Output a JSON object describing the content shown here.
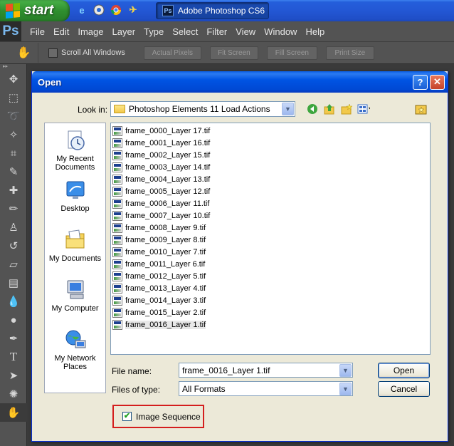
{
  "taskbar": {
    "start_label": "start",
    "task_label": "Adobe Photoshop CS6"
  },
  "menubar": {
    "logo": "Ps",
    "items": [
      "File",
      "Edit",
      "Image",
      "Layer",
      "Type",
      "Select",
      "Filter",
      "View",
      "Window",
      "Help"
    ]
  },
  "options_bar": {
    "scroll_all_label": "Scroll All Windows",
    "buttons": [
      "Actual Pixels",
      "Fit Screen",
      "Fill Screen",
      "Print Size"
    ]
  },
  "dialog": {
    "title": "Open",
    "help_symbol": "?",
    "close_symbol": "✕",
    "look_in_label": "Look in:",
    "look_in_value": "Photoshop Elements 11 Load Actions",
    "places": [
      "My Recent Documents",
      "Desktop",
      "My Documents",
      "My Computer",
      "My Network Places"
    ],
    "files": [
      "frame_0000_Layer 17.tif",
      "frame_0001_Layer 16.tif",
      "frame_0002_Layer 15.tif",
      "frame_0003_Layer 14.tif",
      "frame_0004_Layer 13.tif",
      "frame_0005_Layer 12.tif",
      "frame_0006_Layer 11.tif",
      "frame_0007_Layer 10.tif",
      "frame_0008_Layer 9.tif",
      "frame_0009_Layer 8.tif",
      "frame_0010_Layer 7.tif",
      "frame_0011_Layer 6.tif",
      "frame_0012_Layer 5.tif",
      "frame_0013_Layer 4.tif",
      "frame_0014_Layer 3.tif",
      "frame_0015_Layer 2.tif",
      "frame_0016_Layer 1.tif"
    ],
    "file_name_label": "File name:",
    "file_name_value": "frame_0016_Layer 1.tif",
    "file_type_label": "Files of type:",
    "file_type_value": "All Formats",
    "open_label": "Open",
    "cancel_label": "Cancel",
    "image_sequence_label": "Image Sequence",
    "image_sequence_checked": true
  },
  "colors": {
    "ps_panel": "#535353",
    "xp_title": "#0054e3",
    "dialog_bg": "#ece9d8",
    "highlight_border": "#d41e1e"
  }
}
